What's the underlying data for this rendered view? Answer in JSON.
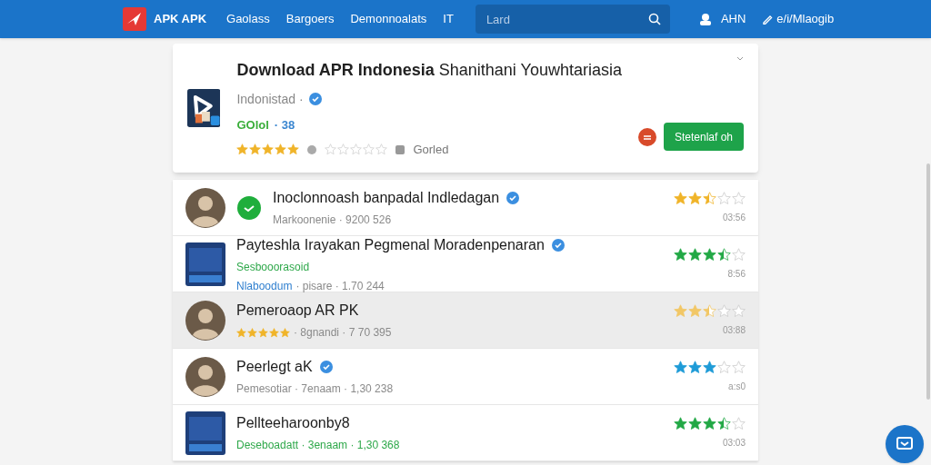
{
  "header": {
    "logo": "APK APK",
    "nav": [
      "Gaolass",
      "Bargoers",
      "Demonnoalats",
      "IT"
    ],
    "search": {
      "placeholder": "Lard"
    },
    "account": "AHN",
    "signin": "e/i/Mlaogib"
  },
  "app": {
    "title": "Download APR Indonesia",
    "title_rest": "Shanithani Youwhtariasia",
    "developer": "Indonistad ·",
    "version": "GOlol",
    "size": "· 38",
    "stars": 5,
    "rating": {
      "stars": 0
    },
    "status": "Gorled",
    "install": "Stetenlaf oh"
  },
  "rows": [
    {
      "kind": "photo",
      "title": "Inoclonnoash banpadal Indledagan",
      "verified": true,
      "lines": [
        {
          "parts": [
            {
              "text": "Markoonenie · 9200 526",
              "color": "#8a8a8a"
            }
          ]
        }
      ],
      "stars": 2.5,
      "color": "#f0b429",
      "reading": "03:56",
      "selected": false
    },
    {
      "kind": "app",
      "title": "Payteshla Irayakan Pegmenal Moradenpenaran",
      "verified": true,
      "lines": [
        {
          "parts": [
            {
              "text": "Sesbooorasoid",
              "color": "#2ea84a"
            }
          ]
        },
        {
          "parts": [
            {
              "text": "Nlaboodum",
              "color": "#2f7fcf"
            },
            {
              "text": "· pisare · 1.70 244",
              "color": "#8a8a8a"
            }
          ]
        }
      ],
      "stars": 3.5,
      "color": "#22a845",
      "reading": "8:56",
      "selected": false
    },
    {
      "kind": "photo",
      "title": "Pemeroaop AR PK",
      "verified": false,
      "inline": {
        "stars": 5
      },
      "lines": [
        {
          "parts": [
            {
              "text": "· 8gnandi · 7 70 395",
              "color": "#8a8a8a"
            }
          ]
        }
      ],
      "stars": 2.5,
      "color": "#f2c766",
      "reading": "03:88",
      "selected": true
    },
    {
      "kind": "photo",
      "title": "Peerlegt aK",
      "verified": true,
      "lines": [
        {
          "parts": [
            {
              "text": "Pemesotiar · 7enaam · 1,30 238",
              "color": "#8a8a8a"
            }
          ]
        }
      ],
      "stars": 3,
      "color": "#1e9bd7",
      "reading": "a:s0",
      "selected": false
    },
    {
      "kind": "app",
      "title": "Pellteeharoonby8",
      "verified": false,
      "lines": [
        {
          "parts": [
            {
              "text": "Deseboadatt · 3enaam · 1,30 368",
              "color": "#2ea84a"
            }
          ]
        }
      ],
      "stars": 3.5,
      "color": "#22a845",
      "reading": "03:03",
      "selected": false
    }
  ]
}
